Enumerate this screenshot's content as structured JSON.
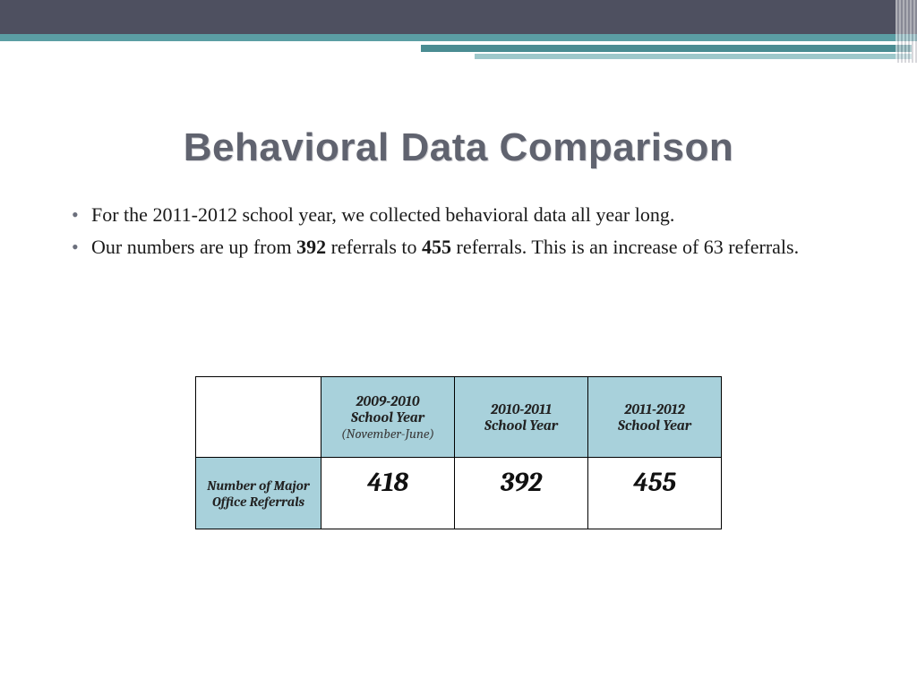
{
  "title": "Behavioral Data Comparison",
  "bullets": {
    "b1": "For the 2011-2012 school year, we collected behavioral data all year long.",
    "b2_pre": " Our numbers are up from ",
    "b2_n1": "392",
    "b2_mid": " referrals to ",
    "b2_n2": "455",
    "b2_post": " referrals. This is an increase of 63 referrals."
  },
  "table": {
    "col1_line1": "2009-2010",
    "col1_line2": "School Year",
    "col1_sub": "(November-June)",
    "col2_line1": "2010-2011",
    "col2_line2": "School Year",
    "col3_line1": "2011-2012",
    "col3_line2": "School Year",
    "row_label": "Number of Major Office Referrals",
    "v1": "418",
    "v2": "392",
    "v3": "455"
  },
  "chart_data": {
    "type": "table",
    "title": "Behavioral Data Comparison",
    "columns": [
      "2009-2010 School Year (November-June)",
      "2010-2011 School Year",
      "2011-2012 School Year"
    ],
    "rows": [
      {
        "label": "Number of Major Office Referrals",
        "values": [
          418,
          392,
          455
        ]
      }
    ]
  }
}
